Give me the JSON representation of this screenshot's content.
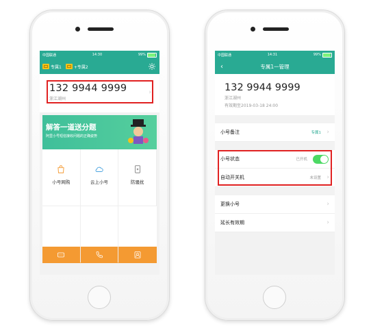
{
  "left_phone": {
    "status": {
      "carrier": "中国联通",
      "time": "14:30",
      "battery": "99%"
    },
    "tabs": [
      {
        "label": "专属1"
      },
      {
        "label": "+专属2"
      }
    ],
    "number_card": {
      "number": "132 9944 9999",
      "location": "浙江湖州"
    },
    "banner": {
      "title": "解答一道送分题",
      "subtitle": "阿里小号短信接收问题的正确姿势"
    },
    "grid": [
      {
        "label": "小号网购",
        "icon": "bag-icon"
      },
      {
        "label": "云上小号",
        "icon": "cloud-icon"
      },
      {
        "label": "防骚扰",
        "icon": "shield-phone-icon"
      }
    ],
    "bottom_bar": [
      {
        "icon": "keypad-icon"
      },
      {
        "icon": "phone-icon"
      },
      {
        "icon": "contacts-icon"
      }
    ],
    "colors": {
      "accent": "#29aa93",
      "orange": "#f49a32",
      "highlight": "#e02020"
    }
  },
  "right_phone": {
    "status": {
      "carrier": "中国联通",
      "time": "14:31",
      "battery": "99%"
    },
    "nav": {
      "title": "专属1一管理"
    },
    "info": {
      "number": "132 9944 9999",
      "location": "浙江湖州",
      "validity": "有效期至2019-03-18 24:00"
    },
    "group1": [
      {
        "label": "小号备注",
        "value": "专属1"
      }
    ],
    "group2": [
      {
        "label": "小号状态",
        "value": "已开机",
        "toggle": true
      },
      {
        "label": "自动开关机",
        "value": "未设置"
      }
    ],
    "group3": [
      {
        "label": "更换小号"
      },
      {
        "label": "延长有效期"
      }
    ]
  }
}
